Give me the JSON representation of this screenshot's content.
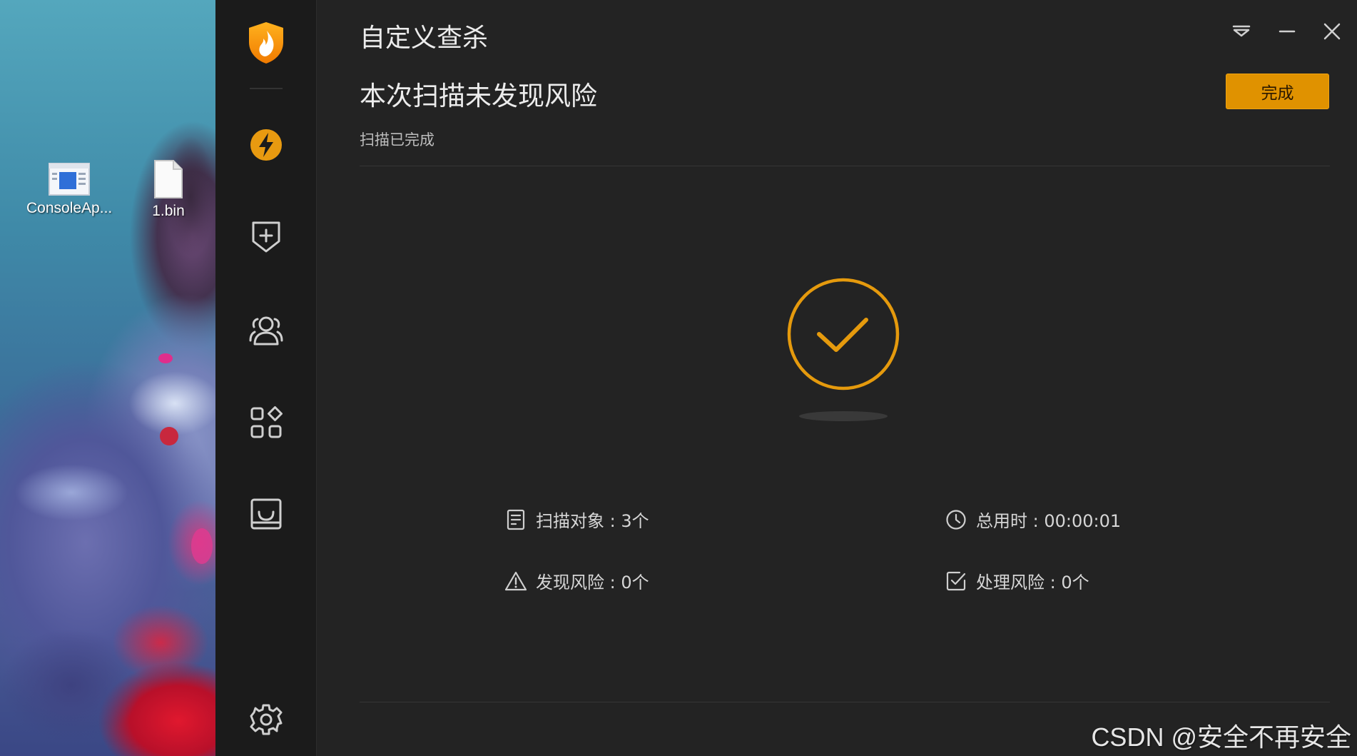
{
  "desktop": {
    "icons": [
      {
        "label": "ConsoleAp...",
        "icon": "exe-window-icon"
      },
      {
        "label": "1.bin",
        "icon": "blank-file-icon"
      }
    ]
  },
  "window": {
    "title": "自定义查杀",
    "controls": {
      "menu": "dropdown-menu-icon",
      "minimize": "minimize-icon",
      "close": "close-icon"
    }
  },
  "sidebar": {
    "items": [
      {
        "name": "logo",
        "icon": "fire-shield-logo-icon"
      },
      {
        "name": "speed-scan",
        "icon": "lightning-icon"
      },
      {
        "name": "protection",
        "icon": "shield-plus-icon"
      },
      {
        "name": "account",
        "icon": "users-icon"
      },
      {
        "name": "toolbox",
        "icon": "apps-grid-icon"
      },
      {
        "name": "quarantine",
        "icon": "tray-icon"
      },
      {
        "name": "settings",
        "icon": "gear-icon"
      }
    ]
  },
  "result": {
    "headline": "本次扫描未发现风险",
    "subtext": "扫描已完成",
    "done_label": "完成",
    "status_icon": "check-circle-icon"
  },
  "stats": {
    "scan_objects": "扫描对象 : 3个",
    "total_time": "总用时 : 00:00:01",
    "risks_found": "发现风险 : 0个",
    "risks_handled": "处理风险 : 0个"
  },
  "watermark": "CSDN @安全不再安全",
  "colors": {
    "accent": "#e09200",
    "window_bg": "#232323",
    "sidebar_bg": "#1b1b1b",
    "text": "#ececec"
  }
}
